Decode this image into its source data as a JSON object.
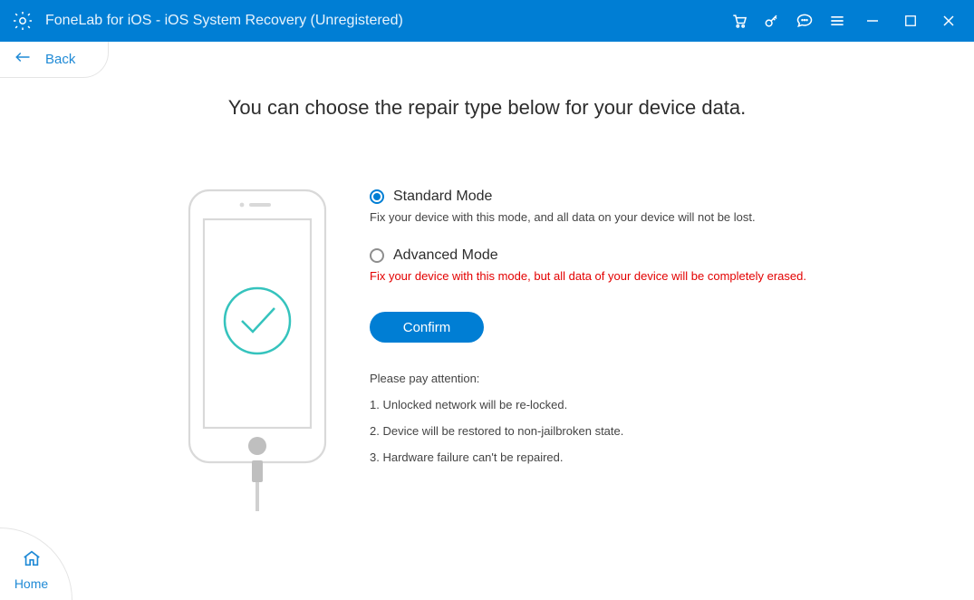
{
  "titlebar": {
    "title": "FoneLab for iOS - iOS System Recovery (Unregistered)"
  },
  "back": {
    "label": "Back"
  },
  "home": {
    "label": "Home"
  },
  "heading": "You can choose the repair type below for your device data.",
  "modes": {
    "standard": {
      "label": "Standard Mode",
      "desc": "Fix your device with this mode, and all data on your device will not be lost.",
      "selected": true
    },
    "advanced": {
      "label": "Advanced Mode",
      "desc": "Fix your device with this mode, but all data of your device will be completely erased.",
      "selected": false
    }
  },
  "confirm": {
    "label": "Confirm"
  },
  "attention": {
    "header": "Please pay attention:",
    "items": [
      "1. Unlocked network will be re-locked.",
      "2. Device will be restored to non-jailbroken state.",
      "3. Hardware failure can't be repaired."
    ]
  },
  "colors": {
    "accent": "#007ed4",
    "danger": "#e30000"
  }
}
